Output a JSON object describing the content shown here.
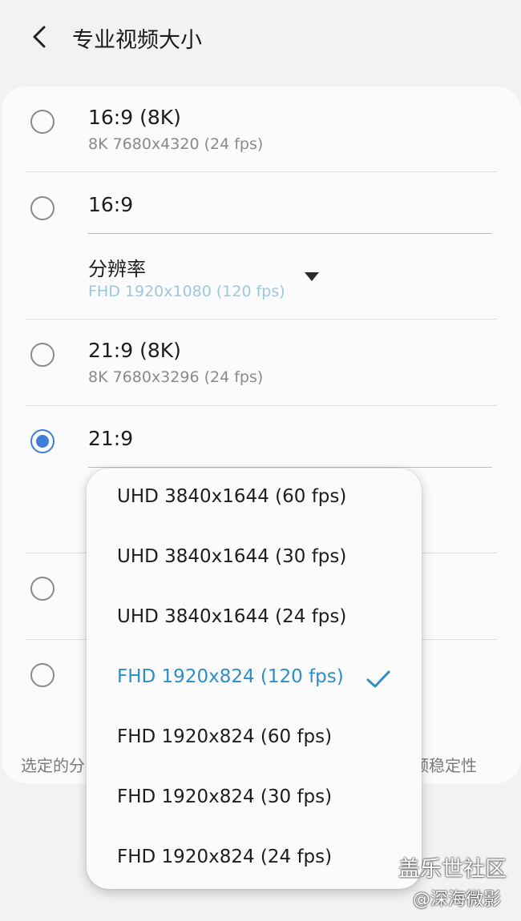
{
  "header": {
    "title": "专业视频大小"
  },
  "options": [
    {
      "title": "16:9 (8K)",
      "subtitle": "8K 7680x4320 (24 fps)",
      "checked": false
    },
    {
      "title": "16:9",
      "checked": false,
      "resolution_label": "分辨率",
      "resolution_value": "FHD 1920x1080 (120 fps)"
    },
    {
      "title": "21:9 (8K)",
      "subtitle": "8K 7680x3296 (24 fps)",
      "checked": false
    },
    {
      "title": "21:9",
      "checked": true
    },
    {
      "title": "",
      "checked": false
    },
    {
      "title": "",
      "checked": false
    }
  ],
  "footnote": {
    "left": "选定的分",
    "right": "频稳定性"
  },
  "popup": {
    "items": [
      {
        "label": "UHD 3840x1644 (60 fps)",
        "selected": false
      },
      {
        "label": "UHD 3840x1644 (30 fps)",
        "selected": false
      },
      {
        "label": "UHD 3840x1644 (24 fps)",
        "selected": false
      },
      {
        "label": "FHD 1920x824 (120 fps)",
        "selected": true
      },
      {
        "label": "FHD 1920x824 (60 fps)",
        "selected": false
      },
      {
        "label": "FHD 1920x824 (30 fps)",
        "selected": false
      },
      {
        "label": "FHD 1920x824 (24 fps)",
        "selected": false
      }
    ]
  },
  "watermark": {
    "line1": "盖乐世社区",
    "line2": "@深海微影"
  },
  "colors": {
    "accent": "#3e7fd8",
    "selected_text": "#2e8fc8",
    "muted_value": "#9ec7de"
  }
}
